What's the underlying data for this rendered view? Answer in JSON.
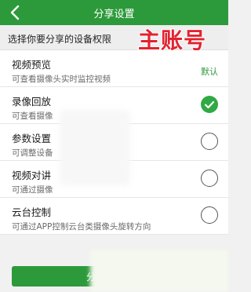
{
  "header": {
    "title": "分享设置"
  },
  "section": {
    "prompt": "选择你要分享的设备权限"
  },
  "overlay": {
    "watermark": "主账号"
  },
  "permissions": [
    {
      "title": "视频预览",
      "desc": "可查看摄像头实时监控视频",
      "state": "默认"
    },
    {
      "title": "录像回放",
      "desc": "可查看摄像",
      "state": "checked"
    },
    {
      "title": "参数设置",
      "desc": "可调整设备",
      "state": "unchecked"
    },
    {
      "title": "视频对讲",
      "desc": "可通过摄像",
      "state": "unchecked"
    },
    {
      "title": "云台控制",
      "desc": "可通过APP控制云台类摄像头旋转方向",
      "state": "unchecked"
    }
  ],
  "footer": {
    "button_label": "分"
  },
  "colors": {
    "brand": "#2c9a3b",
    "watermark": "#e2232f"
  }
}
